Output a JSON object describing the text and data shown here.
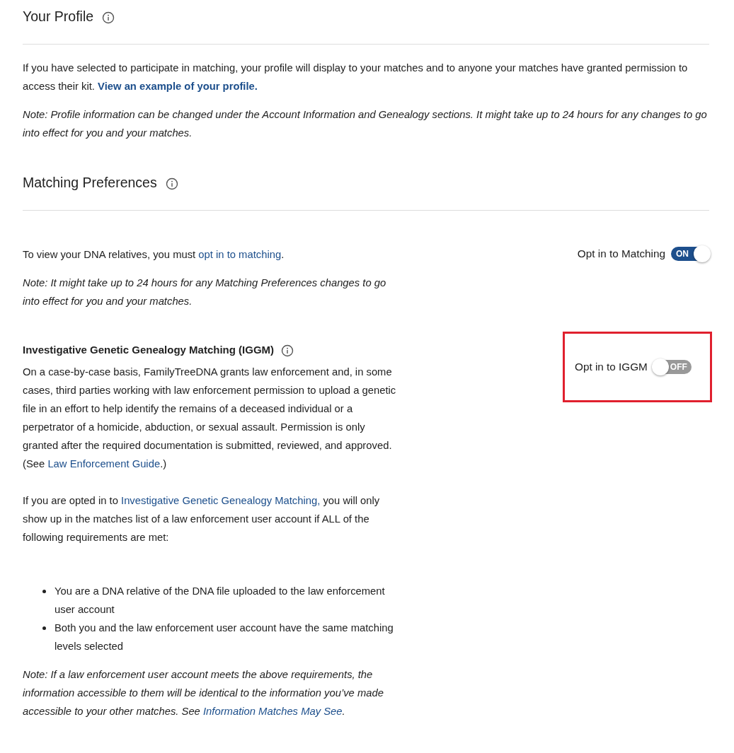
{
  "profile": {
    "title": "Your Profile",
    "intro": [
      {
        "kind": "text",
        "text": "If you have selected to participate in matching, your profile will display to your matches and to anyone your matches have granted permission to access their kit. "
      },
      {
        "kind": "link",
        "text": "View an example of your profile."
      }
    ],
    "note": "Note: Profile information can be changed under the Account Information and Genealogy sections. It might take up to 24 hours for any changes to go into effect for you and your matches."
  },
  "matching": {
    "title": "Matching Preferences",
    "intro": [
      {
        "kind": "text",
        "text": "To view your DNA relatives, you must "
      },
      {
        "kind": "link",
        "text": "opt in to matching"
      },
      {
        "kind": "text",
        "text": "."
      }
    ],
    "note": "Note: It might take up to 24 hours for any Matching Preferences changes to go into effect for you and your matches.",
    "toggle": {
      "label": "Opt in to Matching",
      "on": true,
      "text": "ON"
    }
  },
  "iggm": {
    "title": "Investigative Genetic Genealogy Matching (IGGM)",
    "paragraphs": [
      [
        {
          "kind": "text",
          "text": "On a case-by-case basis, FamilyTreeDNA grants law enforcement and, in some cases, third parties working with law enforcement permission to upload a genetic file in an effort to help identify the remains of a deceased individual or a perpetrator of a homicide, abduction, or sexual assault. Permission is only granted after the required documentation is submitted, reviewed, and approved. (See "
        },
        {
          "kind": "link",
          "text": "Law Enforcement Guide"
        },
        {
          "kind": "text",
          "text": ".)"
        }
      ],
      [
        {
          "kind": "text",
          "text": "If you are opted in to "
        },
        {
          "kind": "link",
          "text": "Investigative Genetic Genealogy Matching,"
        },
        {
          "kind": "text",
          "text": " you will only show up in the matches list of a law enforcement user account if ALL of the following requirements are met:"
        }
      ]
    ],
    "requirements": [
      "You are a DNA relative of the DNA file uploaded to the law enforcement user account",
      "Both you and the law enforcement user account have the same matching levels selected"
    ],
    "note": [
      {
        "kind": "text",
        "text": "Note: If a law enforcement user account meets the above requirements, the information accessible to them will be identical to the information you’ve made accessible to your other matches. See "
      },
      {
        "kind": "link",
        "text": "Information Matches May See"
      },
      {
        "kind": "text",
        "text": "."
      }
    ],
    "toggle": {
      "label": "Opt in to IGGM",
      "on": false,
      "text": "OFF",
      "highlighted": true
    }
  }
}
